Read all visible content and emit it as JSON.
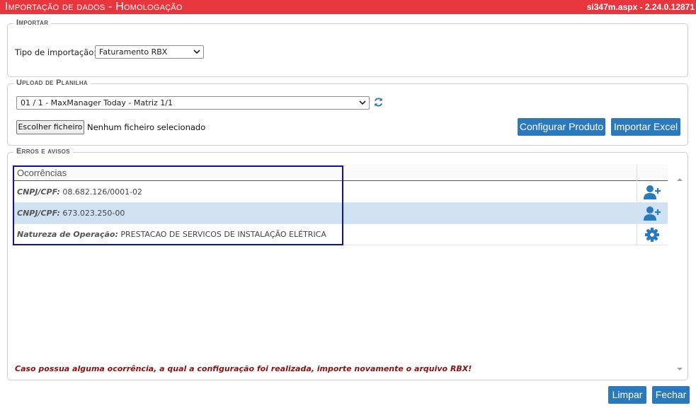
{
  "header": {
    "title": "Importação de dados  - Homologação",
    "version": "si347m.aspx - 2.24.0.12871"
  },
  "importar": {
    "legend": "Importar",
    "tipo_label": "Tipo de importação:",
    "tipo_value": "Faturamento RBX"
  },
  "upload": {
    "legend": "Upload de Planilha",
    "planilha_value": "01 / 1 - MaxManager Today - Matriz 1/1",
    "file_button": "Escolher ficheiro",
    "file_status": "Nenhum ficheiro selecionado",
    "configurar_label": "Configurar Produto",
    "importar_label": "Importar Excel"
  },
  "erros": {
    "legend": "Erros e avisos",
    "column_header": "Ocorrências",
    "rows": [
      {
        "label": "CNPJ/CPF:",
        "value": "08.682.126/0001-02",
        "action_icon": "add-user-icon",
        "selected": false
      },
      {
        "label": "CNPJ/CPF:",
        "value": "673.023.250-00",
        "action_icon": "add-user-icon",
        "selected": true
      },
      {
        "label": "Natureza de Operação:",
        "value": "PRESTACAO DE SERVICOS DE INSTALAÇÃO ELÉTRICA",
        "action_icon": "gear-icon",
        "selected": false
      }
    ],
    "warning": "Caso possua alguma ocorrência, a qual a configuração foi realizada, importe novamente o arquivo RBX!"
  },
  "footer": {
    "limpar_label": "Limpar",
    "fechar_label": "Fechar"
  },
  "colors": {
    "header_bg": "#e8363f",
    "button_bg": "#2a79bd",
    "selected_row": "#cfe2f3",
    "warning_text": "#8b1010",
    "highlight_border": "#1010a8"
  }
}
